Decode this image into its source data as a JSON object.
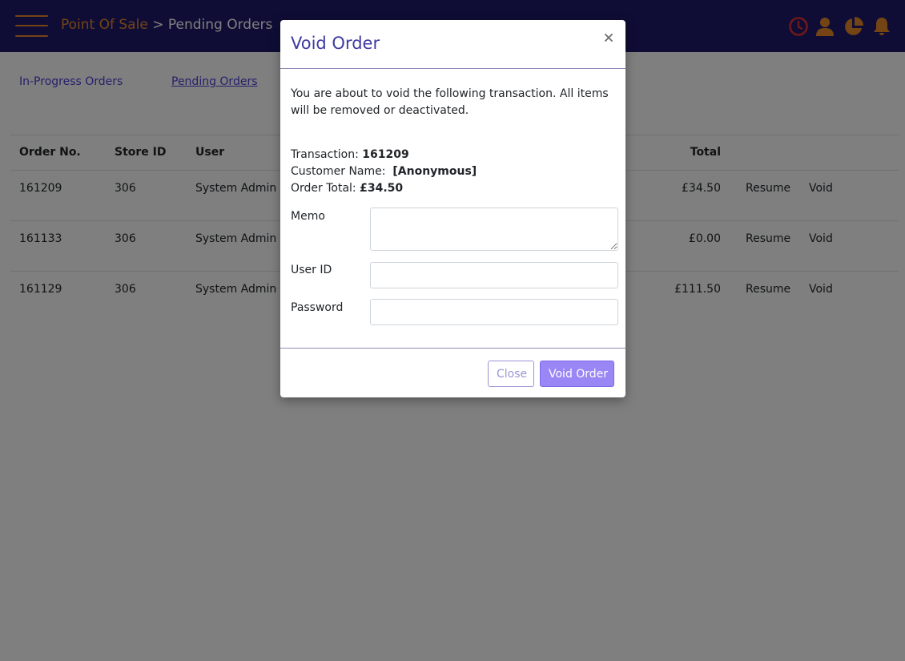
{
  "header": {
    "crumb_root": "Point Of Sale",
    "crumb_separator": ">",
    "crumb_current": "Pending Orders",
    "icons": [
      "clock-icon",
      "user-icon",
      "pie-chart-icon",
      "bell-icon"
    ],
    "colors": {
      "background": "#1e1b6b",
      "accent": "#e8892a",
      "clock": "#e03030"
    }
  },
  "subnav": {
    "in_progress": "In-Progress Orders",
    "pending": "Pending Orders"
  },
  "orders": {
    "columns": {
      "order_no": "Order No.",
      "store_id": "Store ID",
      "user": "User",
      "total": "Total"
    },
    "rows": [
      {
        "order_no": "161209",
        "store_id": "306",
        "user": "System Admin",
        "total": "£34.50",
        "resume": "Resume",
        "void": "Void"
      },
      {
        "order_no": "161133",
        "store_id": "306",
        "user": "System Admin",
        "total": "£0.00",
        "resume": "Resume",
        "void": "Void"
      },
      {
        "order_no": "161129",
        "store_id": "306",
        "user": "System Admin",
        "total": "£111.50",
        "resume": "Resume",
        "void": "Void"
      }
    ]
  },
  "modal": {
    "title": "Void Order",
    "close_glyph": "×",
    "message": "You are about to void the following transaction. All items will be removed or deactivated.",
    "transaction_label": "Transaction:",
    "transaction_value": "161209",
    "customer_label": "Customer Name:",
    "customer_value": "[Anonymous]",
    "total_label": "Order Total:",
    "total_value": "£34.50",
    "memo_label": "Memo",
    "memo_value": "",
    "userid_label": "User ID",
    "userid_value": "",
    "password_label": "Password",
    "password_value": "",
    "close_button": "Close",
    "void_button": "Void Order"
  }
}
